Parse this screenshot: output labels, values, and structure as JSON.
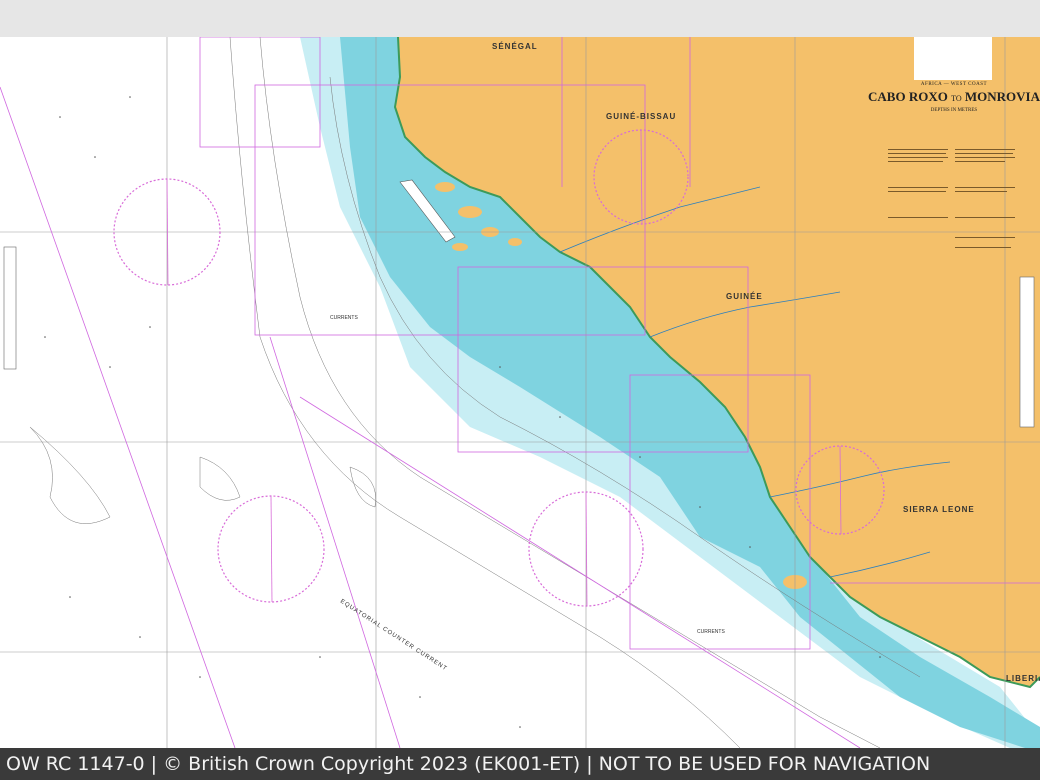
{
  "map": {
    "countries": [
      {
        "key": "senegal",
        "label": "SÉNÉGAL"
      },
      {
        "key": "guinea-bissau",
        "label": "GUINÉ-BISSAU"
      },
      {
        "key": "guinea",
        "label": "GUINÉE"
      },
      {
        "key": "sierra-leone",
        "label": "SIERRA LEONE"
      },
      {
        "key": "liberia",
        "label": "LIBERIA"
      }
    ],
    "current_labels": [
      "CURRENTS",
      "CURRENTS"
    ],
    "counter_current_label": "EQUATORIAL COUNTER CURRENT",
    "colors": {
      "land": "#f4c06a",
      "deep_water": "#ffffff",
      "shallow_water": "#7fd3e0",
      "mid_water": "#c8eef4",
      "limit_lines": "#d067e0",
      "compass": "#d86bd8",
      "graticule": "#9a9a9a"
    }
  },
  "title_block": {
    "region": "AFRICA — WEST COAST",
    "title_main": "CABO ROXO",
    "title_to": "TO",
    "title_end": "MONROVIA",
    "depths": "DEPTHS IN METRES"
  },
  "footer": {
    "text": "OW RC 1147-0 | © British Crown Copyright 2023 (EK001-ET) | NOT TO BE USED FOR NAVIGATION"
  }
}
